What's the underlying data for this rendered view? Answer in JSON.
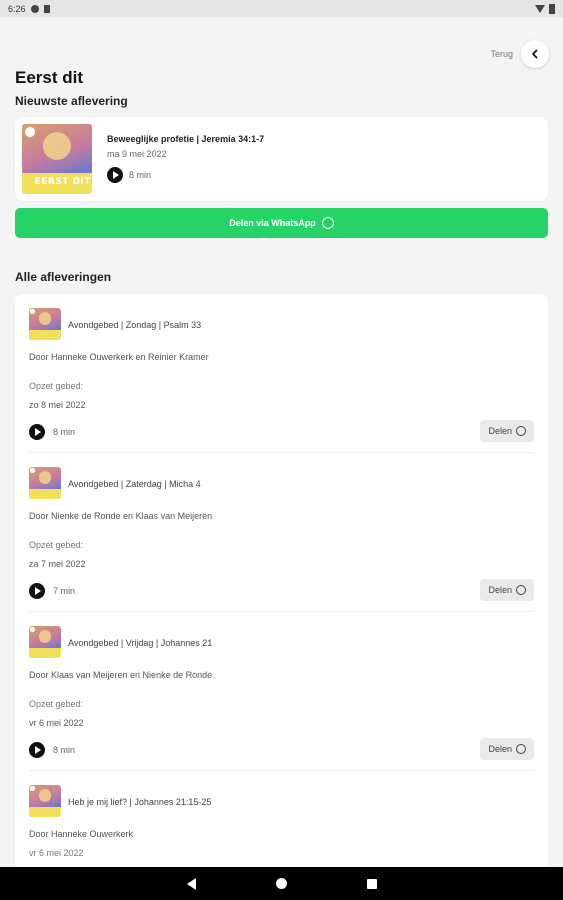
{
  "status_bar": {
    "time": "6:26"
  },
  "header": {
    "back_label": "Terug",
    "title": "Eerst dit"
  },
  "latest": {
    "section_title": "Nieuwste aflevering",
    "cover_text": "EERST DIT",
    "title": "Beweeglijke profetie | Jeremia 34:1-7",
    "date": "ma 9 mei 2022",
    "duration": "8 min"
  },
  "whatsapp_button": {
    "label": "Delen via WhatsApp",
    "color": "#25d366"
  },
  "all": {
    "section_title": "Alle afleveringen",
    "episodes": [
      {
        "title": "Avondgebed | Zondag | Psalm 33",
        "hosts": "Door Hanneke Ouwerkerk en Reinier Kramer",
        "label": "Opzet gebed:",
        "date": "zo 8 mei 2022",
        "duration": "8 min",
        "share": "Delen"
      },
      {
        "title": "Avondgebed | Zaterdag | Micha 4",
        "hosts": "Door Nienke de Ronde en Klaas van Meijeren",
        "label": "Opzet gebed:",
        "date": "za 7 mei 2022",
        "duration": "7 min",
        "share": "Delen"
      },
      {
        "title": "Avondgebed | Vrijdag | Johannes 21",
        "hosts": "Door Klaas van Meijeren en Nienke de Ronde",
        "label": "Opzet gebed:",
        "date": "vr 6 mei 2022",
        "duration": "8 min",
        "share": "Delen"
      },
      {
        "title": "Heb je mij lief? | Johannes 21:15-25",
        "hosts": "Door Hanneke Ouwerkerk",
        "date": "vr 6 mei 2022"
      }
    ]
  }
}
